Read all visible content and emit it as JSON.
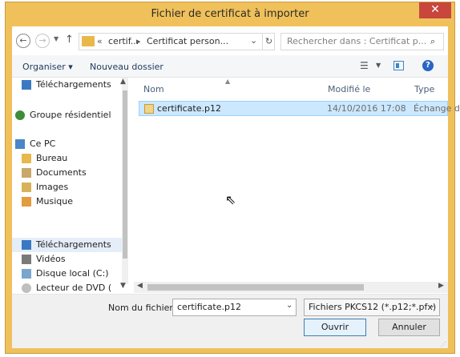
{
  "window": {
    "title": "Fichier de certificat à importer",
    "close_glyph": "✕"
  },
  "address_bar": {
    "path_chevron": "«",
    "segment_1": "certif...",
    "separator": "▸",
    "segment_2": "Certificat person...",
    "search_placeholder": "Rechercher dans : Certificat p..."
  },
  "toolbar": {
    "organise_label": "Organiser ▾",
    "new_folder_label": "Nouveau dossier",
    "help_glyph": "?"
  },
  "navigation": {
    "items": [
      {
        "label": "Téléchargements",
        "icon": "downloads-folder-icon"
      },
      {
        "label": "Groupe résidentiel",
        "icon": "homegroup-icon"
      },
      {
        "label": "Ce PC",
        "icon": "this-pc-icon"
      },
      {
        "label": "Bureau",
        "icon": "desktop-folder-icon"
      },
      {
        "label": "Documents",
        "icon": "documents-folder-icon"
      },
      {
        "label": "Images",
        "icon": "pictures-folder-icon"
      },
      {
        "label": "Musique",
        "icon": "music-folder-icon"
      },
      {
        "label": "Téléchargements",
        "icon": "downloads-folder-icon",
        "selected": true
      },
      {
        "label": "Vidéos",
        "icon": "videos-folder-icon"
      },
      {
        "label": "Disque local (C:)",
        "icon": "local-disk-icon"
      },
      {
        "label": "Lecteur de DVD (",
        "icon": "dvd-drive-icon"
      }
    ]
  },
  "file_list": {
    "columns": [
      "Nom",
      "Modifié le",
      "Type"
    ],
    "rows": [
      {
        "name": "certificate.p12",
        "modified": "14/10/2016 17:08",
        "type": "Échange d",
        "selected": true
      }
    ]
  },
  "footer": {
    "filename_label": "Nom du fichier :",
    "filename_value": "certificate.p12",
    "filter_value": "Fichiers PKCS12 (*.p12;*.pfx)",
    "open_label": "Ouvrir",
    "cancel_label": "Annuler"
  },
  "colors": {
    "titlebar": "#f0c15a",
    "close": "#c9463d",
    "selection": "#cce8ff",
    "accent": "#3c7fb1"
  }
}
